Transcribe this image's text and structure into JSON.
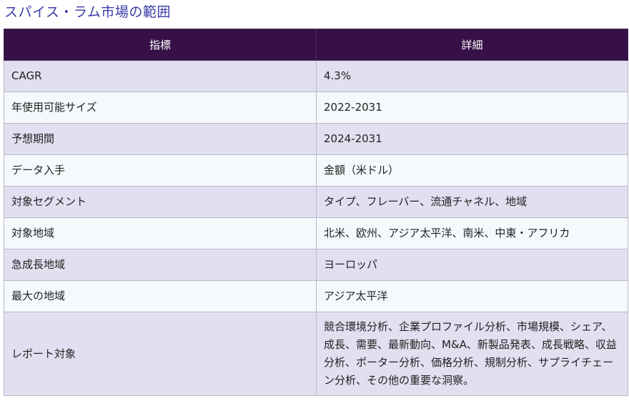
{
  "page": {
    "title": "スパイス・ラム市場の範囲"
  },
  "table": {
    "headers": [
      "指標",
      "詳細"
    ],
    "rows": [
      {
        "metric": "CAGR",
        "detail": "4.3%"
      },
      {
        "metric": "年使用可能サイズ",
        "detail": "2022-2031"
      },
      {
        "metric": "予想期間",
        "detail": "2024-2031"
      },
      {
        "metric": "データ入手",
        "detail": "金額（米ドル）"
      },
      {
        "metric": "対象セグメント",
        "detail": "タイプ、フレーバー、流通チャネル、地域"
      },
      {
        "metric": "対象地域",
        "detail": "北米、欧州、アジア太平洋、南米、中東・アフリカ"
      },
      {
        "metric": "急成長地域",
        "detail": "ヨーロッパ"
      },
      {
        "metric": "最大の地域",
        "detail": "アジア太平洋"
      },
      {
        "metric": "レポート対象",
        "detail": "競合環境分析、企業プロファイル分析、市場規模、シェア、成長、需要、最新動向、M&A、新製品発表、成長戦略、収益分析、ポーター分析、価格分析、規制分析、サプライチェーン分析、その他の重要な洞察。"
      }
    ]
  },
  "colors": {
    "title": "#3a3ba8",
    "header_bg": "#361046",
    "row_odd_bg": "#e2dff0",
    "row_even_bg": "#f4f9fc"
  }
}
